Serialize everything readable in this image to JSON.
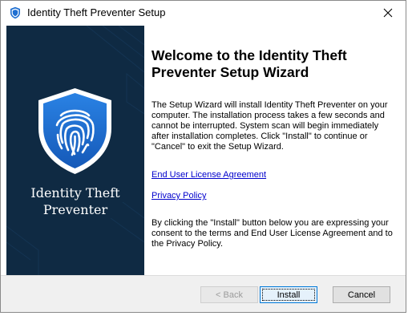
{
  "window": {
    "title": "Identity Theft Preventer Setup"
  },
  "sidebar": {
    "product_name_line1": "Identity Theft",
    "product_name_line2": "Preventer",
    "logo_icon": "shield-fingerprint-icon"
  },
  "main": {
    "heading": "Welcome to the Identity Theft Preventer Setup Wizard",
    "description": "The Setup Wizard will install Identity Theft Preventer on your computer. The installation process takes a few seconds and cannot be interrupted. System scan will begin immediately after installation completes. Click \"Install\" to continue or \"Cancel\" to exit the Setup Wizard.",
    "eula_link": "End User License Agreement",
    "privacy_link": "Privacy Policy",
    "consent": "By clicking the \"Install\" button below you are expressing your consent to the terms and  End User License Agreement and to the Privacy Policy."
  },
  "footer": {
    "back_label": "< Back",
    "install_label": "Install",
    "cancel_label": "Cancel"
  },
  "colors": {
    "sidebar_bg": "#0f2a43",
    "shield_blue": "#1f6fd1",
    "link": "#0000cc"
  }
}
